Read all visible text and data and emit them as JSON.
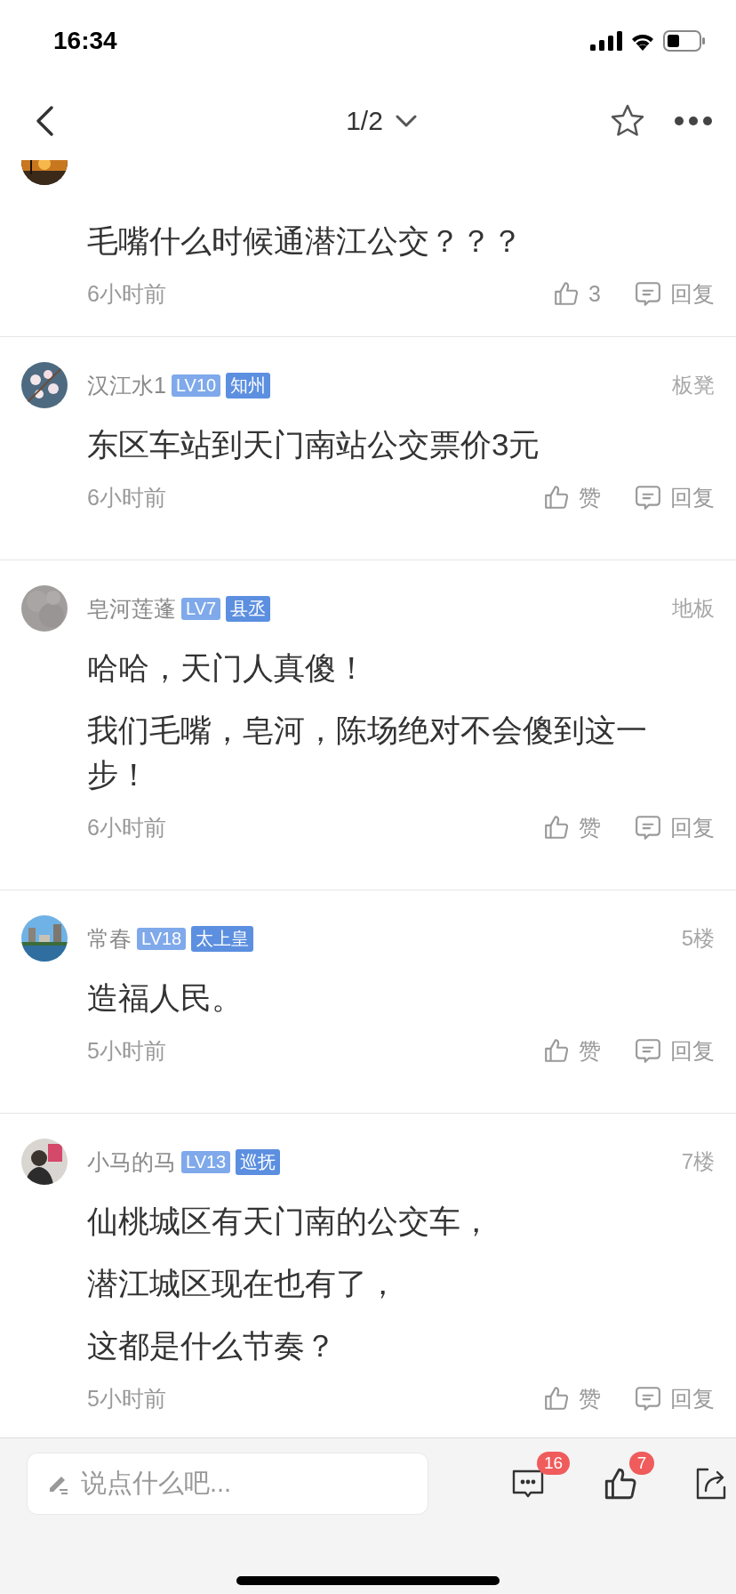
{
  "status_bar": {
    "time": "16:34"
  },
  "nav": {
    "page": "1/2"
  },
  "posts": [
    {
      "kind": "partial",
      "content": [
        "毛嘴什么时候通潜江公交？？？"
      ],
      "time": "6小时前",
      "like": "3",
      "reply": "回复"
    },
    {
      "kind": "full",
      "author": "汉江水1",
      "level": "LV10",
      "rank": "知州",
      "floor": "板凳",
      "content": [
        "东区车站到天门南站公交票价3元"
      ],
      "time": "6小时前",
      "like": "赞",
      "reply": "回复"
    },
    {
      "kind": "full",
      "author": "皂河莲蓬",
      "level": "LV7",
      "rank": "县丞",
      "floor": "地板",
      "content": [
        "哈哈，天门人真傻！",
        "我们毛嘴，皂河，陈场绝对不会傻到这一步！"
      ],
      "time": "6小时前",
      "like": "赞",
      "reply": "回复"
    },
    {
      "kind": "full",
      "author": "常春",
      "level": "LV18",
      "rank": "太上皇",
      "floor": "5楼",
      "content": [
        "造福人民。"
      ],
      "time": "5小时前",
      "like": "赞",
      "reply": "回复"
    },
    {
      "kind": "full",
      "author": "小马的马",
      "level": "LV13",
      "rank": "巡抚",
      "floor": "7楼",
      "content": [
        "仙桃城区有天门南的公交车，",
        "潜江城区现在也有了，",
        "这都是什么节奏？"
      ],
      "time": "5小时前",
      "like": "赞",
      "reply": "回复"
    }
  ],
  "comment_box": {
    "placeholder": "说点什么吧..."
  },
  "toolbar": {
    "comments": "16",
    "likes": "7"
  }
}
